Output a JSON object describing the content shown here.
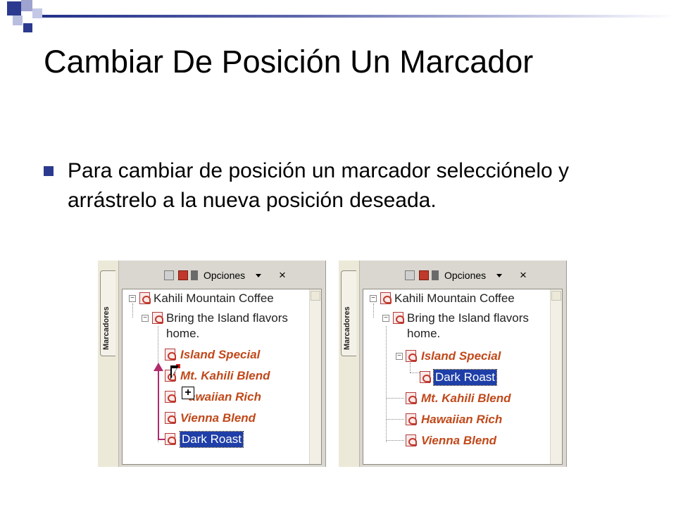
{
  "slide": {
    "title": "Cambiar De Posición Un Marcador",
    "bullet": "Para cambiar de posición un marcador selecciónelo y arrástrelo a la nueva posición deseada."
  },
  "screenshots": {
    "tab_label": "Marcadores",
    "options_label": "Opciones",
    "close_glyph": "×",
    "left": {
      "root": "Kahili Mountain Coffee",
      "child": "Bring the Island flavors",
      "child_cont": "home.",
      "items": [
        "Island Special",
        "Mt. Kahili Blend",
        "awaiian Rich",
        "Vienna Blend"
      ],
      "selected": "Dark Roast"
    },
    "right": {
      "root": "Kahili Mountain Coffee",
      "child": "Bring the Island flavors",
      "child_cont": "home.",
      "item_parent": "Island Special",
      "selected": "Dark Roast",
      "items": [
        "Mt. Kahili Blend",
        "Hawaiian Rich",
        "Vienna Blend"
      ]
    }
  },
  "colors": {
    "accent": "#2b3a8f",
    "bookmark_text": "#c0491a",
    "selection": "#1f3fa8",
    "drag_arrow": "#b02c6b"
  }
}
